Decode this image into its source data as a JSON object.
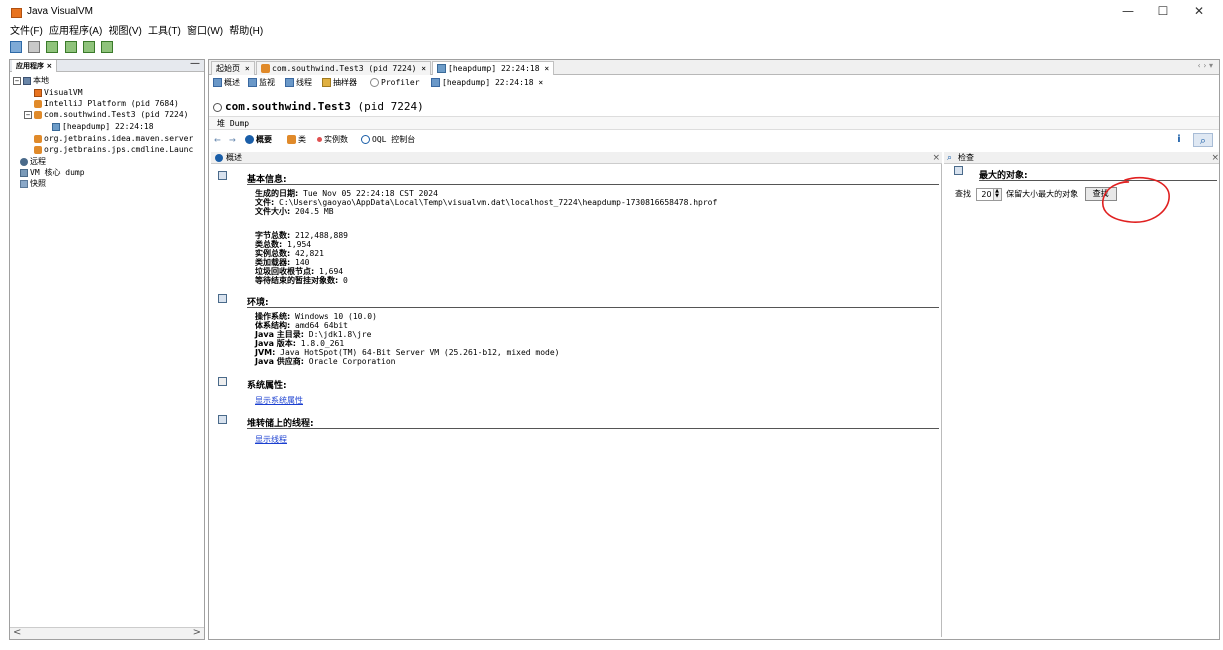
{
  "window": {
    "title": "Java VisualVM",
    "minimize_glyph": "—",
    "maximize_glyph": "☐",
    "close_glyph": "✕"
  },
  "menu": [
    "文件(F)",
    "应用程序(A)",
    "视图(V)",
    "工具(T)",
    "窗口(W)",
    "帮助(H)"
  ],
  "left_panel": {
    "tab_label": "应用程序 ×",
    "minimize_glyph": "—",
    "tree": [
      {
        "label": "本地",
        "icon": "computer-icon"
      },
      {
        "label": "VisualVM",
        "icon": "visualvm-icon"
      },
      {
        "label": "IntelliJ Platform (pid 7684)",
        "icon": "intellij-icon"
      },
      {
        "label": "com.southwind.Test3 (pid 7224)",
        "icon": "java-app-icon"
      },
      {
        "label": "[heapdump] 22:24:18",
        "icon": "heapdump-icon"
      },
      {
        "label": "org.jetbrains.idea.maven.server",
        "icon": "java-app-icon"
      },
      {
        "label": "org.jetbrains.jps.cmdline.Launc",
        "icon": "java-app-icon"
      },
      {
        "label": "远程",
        "icon": "remote-icon"
      },
      {
        "label": "VM 核心 dump",
        "icon": "core-dump-icon"
      },
      {
        "label": "快照",
        "icon": "snapshot-icon"
      }
    ],
    "scroll_left": "<",
    "scroll_right": ">"
  },
  "tabs": [
    {
      "label": "起始页  ×"
    },
    {
      "label": "com.southwind.Test3 (pid 7224)  ×"
    },
    {
      "label": "[heapdump] 22:24:18  ×"
    }
  ],
  "tab_nav": "‹ › ▾",
  "subtabs": [
    "概述",
    "监视",
    "线程",
    "抽样器",
    "Profiler",
    "[heapdump] 22:24:18 ×"
  ],
  "process_header": "com.southwind.Test3",
  "process_pid": "(pid 7224)",
  "heapdump_label": "堆 Dump",
  "nav": {
    "back": "←",
    "forward": "→",
    "items": [
      "概要",
      "类",
      "实例数",
      "OQL 控制台"
    ],
    "info_glyph": "i",
    "search_glyph": "⌕"
  },
  "summary": {
    "header": "概述",
    "close": "×",
    "basic_title": "基本信息:",
    "basic": [
      {
        "k": "生成的日期:",
        "v": " Tue Nov 05 22:24:18 CST 2024"
      },
      {
        "k": "文件:",
        "v": " C:\\Users\\gaoyao\\AppData\\Local\\Temp\\visualvm.dat\\localhost_7224\\heapdump-1730816658478.hprof"
      },
      {
        "k": "文件大小:",
        "v": " 204.5 MB"
      },
      {
        "k": "字节总数:",
        "v": " 212,488,889"
      },
      {
        "k": "类总数:",
        "v": " 1,954"
      },
      {
        "k": "实例总数:",
        "v": " 42,821"
      },
      {
        "k": "类加载器:",
        "v": " 140"
      },
      {
        "k": "垃圾回收根节点:",
        "v": " 1,694"
      },
      {
        "k": "等待结束的暂挂对象数:",
        "v": " 0"
      }
    ],
    "env_title": "环境:",
    "env": [
      {
        "k": "操作系统:",
        "v": " Windows 10 (10.0)"
      },
      {
        "k": "体系结构:",
        "v": " amd64 64bit"
      },
      {
        "k": "Java 主目录:",
        "v": " D:\\jdk1.8\\jre"
      },
      {
        "k": "Java 版本:",
        "v": " 1.8.0_261"
      },
      {
        "k": "JVM:",
        "v": " Java HotSpot(TM) 64-Bit Server VM (25.261-b12, mixed mode)"
      },
      {
        "k": "Java 供应商:",
        "v": " Oracle Corporation"
      }
    ],
    "sysprops_title": "系统属性:",
    "sysprops_link": "显示系统属性",
    "threads_title": "堆转储上的线程:",
    "threads_link": "显示线程"
  },
  "inspect": {
    "header": "检查",
    "close": "×",
    "largest_title": "最大的对象:",
    "find_prefix": "查找",
    "count": "20",
    "find_suffix": "保留大小最大的对象",
    "find_button": "查找"
  },
  "colors": {
    "annotation_red": "#e02020",
    "link_blue": "#1a3fd0",
    "accent_blue": "#1a5ea8"
  }
}
